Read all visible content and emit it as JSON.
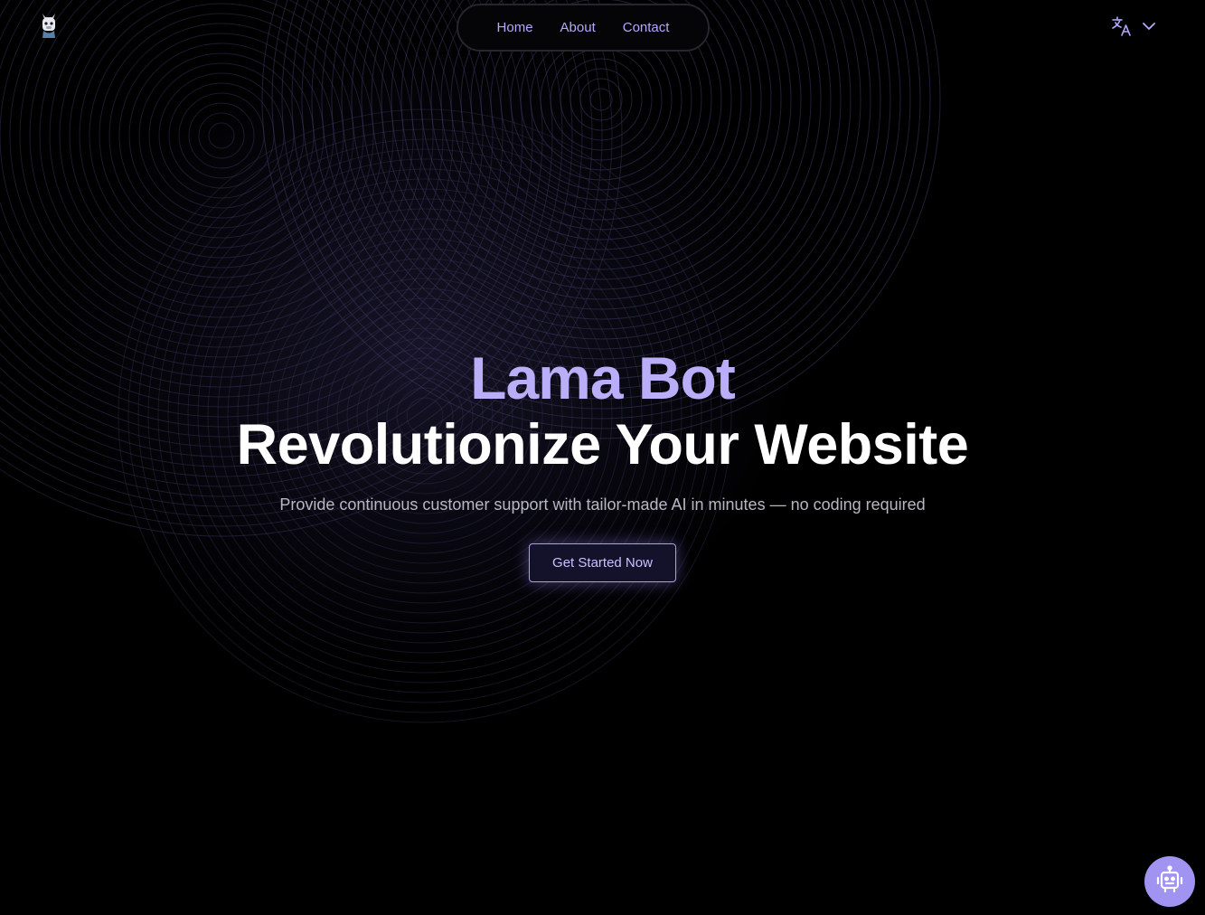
{
  "brand": {
    "logo_icon": "llama-logo-icon"
  },
  "nav": {
    "items": [
      {
        "label": "Home"
      },
      {
        "label": "About"
      },
      {
        "label": "Contact"
      }
    ]
  },
  "language": {
    "icon": "translate-icon",
    "dropdown_icon": "chevron-down-icon"
  },
  "hero": {
    "title": "Lama Bot",
    "headline": "Revolutionize Your Website",
    "description": "Provide continuous customer support with tailor-made AI in minutes — no coding required",
    "cta_label": "Get Started Now"
  },
  "chat_widget": {
    "icon": "robot-icon"
  },
  "colors": {
    "background": "#000000",
    "accent": "#b3a9ff",
    "title_accent": "#b9aef7",
    "fab": "#a093f2"
  }
}
